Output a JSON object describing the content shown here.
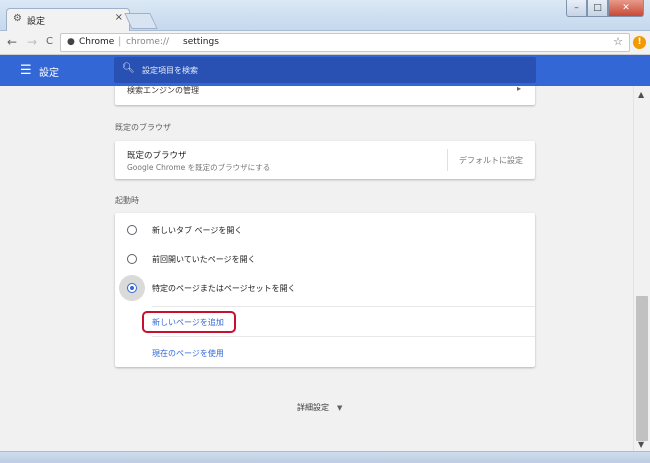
{
  "window": {
    "tab_title": "設定",
    "tab_icon": "gear-icon",
    "minimize": "–",
    "maximize": "□",
    "close": "✕"
  },
  "toolbar": {
    "back": "←",
    "forward": "→",
    "reload": "C",
    "site_label": "Chrome",
    "separator": "|",
    "url_scheme": "chrome://",
    "url_path": "settings",
    "star": "☆",
    "extension_badge": "!"
  },
  "header": {
    "menu_icon": "☰",
    "title": "設定",
    "search_placeholder": "設定項目を検索"
  },
  "sections": {
    "search_engine_row": "検索エンジンの管理",
    "default_browser": {
      "title": "既定のブラウザ",
      "primary": "既定のブラウザ",
      "secondary": "Google Chrome を既定のブラウザにする",
      "button": "デフォルトに設定"
    },
    "startup": {
      "title": "起動時",
      "options": [
        {
          "label": "新しいタブ ページを開く",
          "checked": false
        },
        {
          "label": "前回開いていたページを開く",
          "checked": false
        },
        {
          "label": "特定のページまたはページセットを開く",
          "checked": true
        }
      ],
      "add_page_link": "新しいページを追加",
      "use_current_link": "現在のページを使用"
    },
    "advanced": "詳細設定"
  },
  "colors": {
    "header": "#3367d6",
    "link": "#3367d6",
    "highlight": "#c8102e"
  }
}
